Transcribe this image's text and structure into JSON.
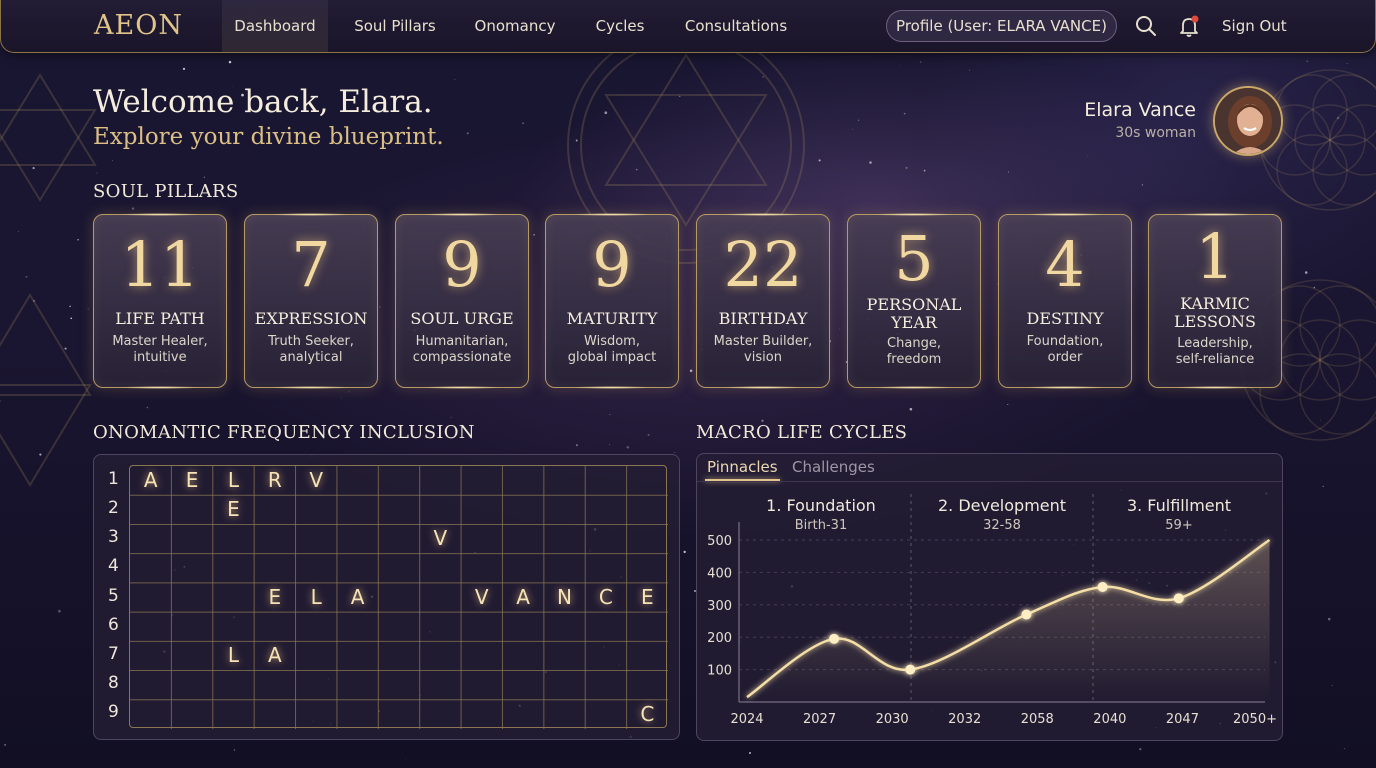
{
  "nav": {
    "logo": "AEON",
    "items": [
      "Dashboard",
      "Soul Pillars",
      "Onomancy",
      "Cycles",
      "Consultations"
    ],
    "active": "Dashboard",
    "profile": "Profile (User: ELARA VANCE)",
    "signout": "Sign Out",
    "icons": [
      "search-icon",
      "bell-icon"
    ]
  },
  "header": {
    "welcome": "Welcome back, Elara.",
    "subtitle": "Explore your divine blueprint."
  },
  "user": {
    "name": "Elara Vance",
    "description": "30s woman"
  },
  "pillars": {
    "title": "SOUL PILLARS",
    "cards": [
      {
        "number": "11",
        "label": "LIFE PATH",
        "desc1": "Master Healer,",
        "desc2": "intuitive"
      },
      {
        "number": "7",
        "label": "EXPRESSION",
        "desc1": "Truth Seeker,",
        "desc2": "analytical"
      },
      {
        "number": "9",
        "label": "SOUL URGE",
        "desc1": "Humanitarian,",
        "desc2": "compassionate"
      },
      {
        "number": "9",
        "label": "MATURITY",
        "desc1": "Wisdom,",
        "desc2": "global impact"
      },
      {
        "number": "22",
        "label": "BIRTHDAY",
        "desc1": "Master Builder,",
        "desc2": "vision"
      },
      {
        "number": "5",
        "label1": "PERSONAL",
        "label2": "YEAR",
        "desc1": "Change,",
        "desc2": "freedom"
      },
      {
        "number": "4",
        "label": "DESTINY",
        "desc1": "Foundation,",
        "desc2": "order"
      },
      {
        "number": "1",
        "label1": "KARMIC",
        "label2": "LESSONS",
        "desc1": "Leadership,",
        "desc2": "self-reliance"
      }
    ]
  },
  "onomancy": {
    "title": "ONOMANTIC FREQUENCY INCLUSION",
    "row_labels": [
      "1",
      "2",
      "3",
      "4",
      "5",
      "6",
      "7",
      "8",
      "9"
    ],
    "letters": [
      {
        "row": 1,
        "col": 1,
        "ch": "A"
      },
      {
        "row": 1,
        "col": 2,
        "ch": "E"
      },
      {
        "row": 1,
        "col": 3,
        "ch": "L"
      },
      {
        "row": 1,
        "col": 4,
        "ch": "R"
      },
      {
        "row": 1,
        "col": 5,
        "ch": "V"
      },
      {
        "row": 2,
        "col": 3,
        "ch": "E"
      },
      {
        "row": 3,
        "col": 8,
        "ch": "V"
      },
      {
        "row": 5,
        "col": 4,
        "ch": "E"
      },
      {
        "row": 5,
        "col": 5,
        "ch": "L"
      },
      {
        "row": 5,
        "col": 6,
        "ch": "A"
      },
      {
        "row": 5,
        "col": 9,
        "ch": "V"
      },
      {
        "row": 5,
        "col": 10,
        "ch": "A"
      },
      {
        "row": 5,
        "col": 11,
        "ch": "N"
      },
      {
        "row": 5,
        "col": 12,
        "ch": "C"
      },
      {
        "row": 5,
        "col": 13,
        "ch": "E"
      },
      {
        "row": 7,
        "col": 3,
        "ch": "L"
      },
      {
        "row": 7,
        "col": 4,
        "ch": "A"
      },
      {
        "row": 9,
        "col": 13,
        "ch": "C"
      }
    ]
  },
  "cycles": {
    "title": "MACRO LIFE CYCLES",
    "tabs": [
      "Pinnacles",
      "Challenges"
    ],
    "active_tab": "Pinnacles",
    "phases": [
      {
        "name": "1. Foundation",
        "range": "Birth-31"
      },
      {
        "name": "2. Development",
        "range": "32-58"
      },
      {
        "name": "3. Fulfillment",
        "range": "59+"
      }
    ]
  },
  "chart_data": {
    "type": "line",
    "categories": [
      "2024",
      "2027",
      "2030",
      "2032",
      "2058",
      "2040",
      "2047",
      "2050+"
    ],
    "y_ticks": [
      100,
      200,
      300,
      400,
      500
    ],
    "ylim": [
      0,
      560
    ],
    "points": [
      {
        "x": 0,
        "y": 15
      },
      {
        "x": 1.2,
        "y": 195,
        "marker": true
      },
      {
        "x": 2.25,
        "y": 100,
        "marker": true
      },
      {
        "x": 3.85,
        "y": 270,
        "marker": true
      },
      {
        "x": 4.9,
        "y": 355,
        "marker": true
      },
      {
        "x": 5.95,
        "y": 320,
        "marker": true
      },
      {
        "x": 7.2,
        "y": 500
      }
    ],
    "color": "#f4dea6"
  }
}
